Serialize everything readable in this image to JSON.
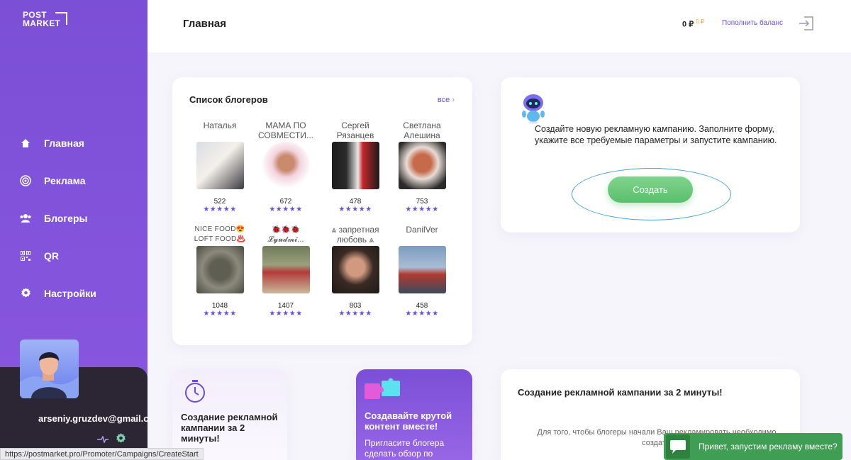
{
  "app": {
    "logo_line1": "POST",
    "logo_line2": "MARKET"
  },
  "sidebar": {
    "items": [
      {
        "label": "Главная",
        "icon": "home-icon"
      },
      {
        "label": "Реклама",
        "icon": "target-icon"
      },
      {
        "label": "Блогеры",
        "icon": "users-icon"
      },
      {
        "label": "QR",
        "icon": "qr-icon"
      },
      {
        "label": "Настройки",
        "icon": "gear-icon"
      }
    ],
    "user_email": "arseniy.gruzdev@gmail.com"
  },
  "header": {
    "title": "Главная",
    "balance": "0 ₽",
    "balance_bonus": "0 ₽",
    "topup_label": "Пополнить баланс"
  },
  "bloggers": {
    "title": "Список блогеров",
    "all_link": "все",
    "items": [
      {
        "name": "Наталья",
        "count": "522",
        "stars": "★★★★★"
      },
      {
        "name": "МАМА ПО СОВМЕСТИ...",
        "count": "672",
        "stars": "★★★★★"
      },
      {
        "name": "Сергей Рязанцев",
        "count": "478",
        "stars": "★★★★★"
      },
      {
        "name": "Светлана Алешина",
        "count": "753",
        "stars": "★★★★★"
      },
      {
        "name": "NICE FOOD😍 LOFT FOOD♨️",
        "count": "1048",
        "stars": "★★★★★"
      },
      {
        "name": "🐞🐞🐞 𝓛𝔂𝓾𝓭𝓶𝓲...",
        "count": "1407",
        "stars": "★★★★★"
      },
      {
        "name": "⩓ запретная любовь ⩓",
        "count": "803",
        "stars": "★★★★★"
      },
      {
        "name": "DanilVer",
        "count": "458",
        "stars": "★★★★★"
      }
    ]
  },
  "create_campaign": {
    "text": "Создайте новую рекламную кампанию. Заполните форму, укажите все требуемые параметры и запустите кампанию.",
    "button_label": "Создать"
  },
  "promo1": {
    "title": "Создание рекламной кампании за 2 минуты!"
  },
  "promo2": {
    "title": "Создавайте крутой контент вместе!",
    "subtitle": "Пригласите блогера сделать обзор по"
  },
  "info_card": {
    "title": "Создание рекламной кампании за 2 минуты!",
    "text": "Для того, чтобы блогеры начали Ваш рекламировать необходимо создат..."
  },
  "status_bar": {
    "url": "https://postmarket.pro/Promoter/Campaigns/CreateStart"
  },
  "chat": {
    "label": "Привет, запустим рекламу вместе?"
  },
  "colors": {
    "brand_purple": "#7b4fd6",
    "accent_green": "#5bbf6c",
    "link_purple": "#6a4fd6"
  }
}
